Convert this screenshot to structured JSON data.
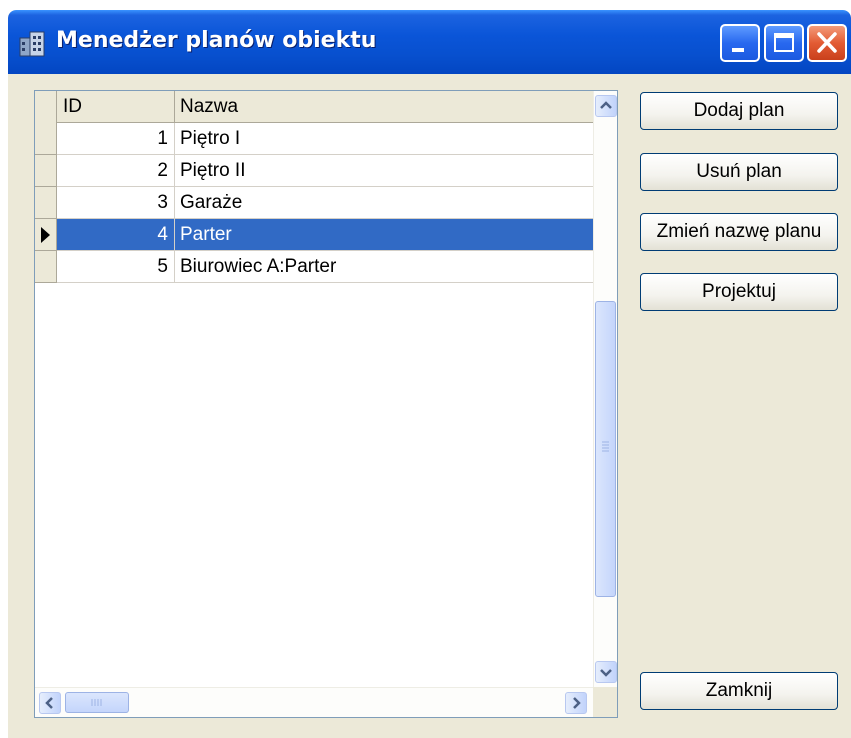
{
  "window": {
    "title": "Menedżer planów obiektu",
    "app_icon": "building-icon",
    "controls": {
      "minimize": "minimize-icon",
      "maximize": "maximize-icon",
      "close": "close-icon"
    }
  },
  "grid": {
    "columns": [
      "ID",
      "Nazwa"
    ],
    "rows": [
      {
        "id": "1",
        "name": "Piętro I"
      },
      {
        "id": "2",
        "name": "Piętro II"
      },
      {
        "id": "3",
        "name": "Garaże"
      },
      {
        "id": "4",
        "name": "Parter"
      },
      {
        "id": "5",
        "name": "Biurowiec A:Parter"
      }
    ],
    "selected_row": "4",
    "current_row_indicator": "arrow-right-icon"
  },
  "buttons": {
    "add": "Dodaj plan",
    "remove": "Usuń plan",
    "rename": "Zmień nazwę planu",
    "design": "Projektuj",
    "close": "Zamknij"
  },
  "colors": {
    "titlebar": "#0a55d8",
    "selection": "#316ac5",
    "dialog_bg": "#ece9d8",
    "close_button": "#e35b34"
  }
}
